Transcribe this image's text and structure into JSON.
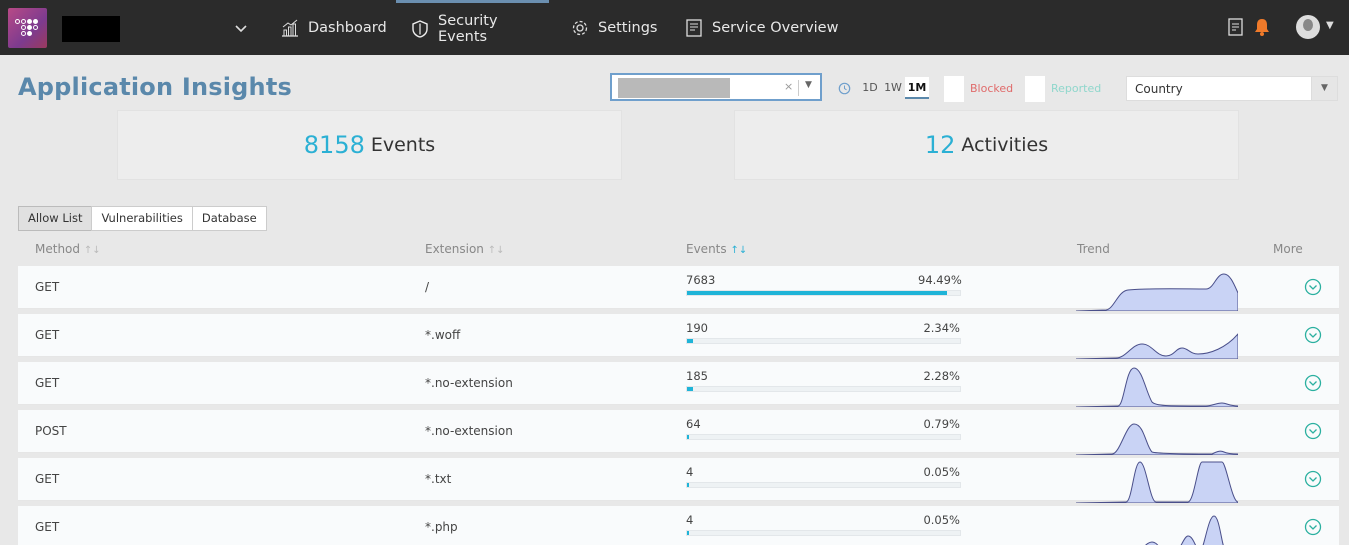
{
  "nav": {
    "items": [
      {
        "label": "Dashboard",
        "icon": "dashboard-chart-icon"
      },
      {
        "label": "Security Events",
        "icon": "shield-icon"
      },
      {
        "label": "Settings",
        "icon": "gear-icon"
      },
      {
        "label": "Service Overview",
        "icon": "document-icon"
      }
    ],
    "active": "Security Events"
  },
  "page": {
    "title": "Application Insights"
  },
  "filters": {
    "time_ranges": [
      "1D",
      "1W",
      "1M"
    ],
    "active_range": "1M",
    "blocked_label": "Blocked",
    "reported_label": "Reported",
    "country_placeholder": "Country"
  },
  "stats": {
    "events_count": "8158",
    "events_label": "Events",
    "activities_count": "12",
    "activities_label": "Activities"
  },
  "tabs": [
    "Allow List",
    "Vulnerabilities",
    "Database"
  ],
  "active_tab": "Allow List",
  "table": {
    "columns": {
      "method": "Method",
      "extension": "Extension",
      "events": "Events",
      "trend": "Trend",
      "more": "More"
    },
    "rows": [
      {
        "method": "GET",
        "extension": "/",
        "events": "7683",
        "percent": "94.49%",
        "fraction": 0.9449
      },
      {
        "method": "GET",
        "extension": "*.woff",
        "events": "190",
        "percent": "2.34%",
        "fraction": 0.0234
      },
      {
        "method": "GET",
        "extension": "*.no-extension",
        "events": "185",
        "percent": "2.28%",
        "fraction": 0.0228
      },
      {
        "method": "POST",
        "extension": "*.no-extension",
        "events": "64",
        "percent": "0.79%",
        "fraction": 0.0079
      },
      {
        "method": "GET",
        "extension": "*.txt",
        "events": "4",
        "percent": "0.05%",
        "fraction": 0.0005
      },
      {
        "method": "GET",
        "extension": "*.php",
        "events": "4",
        "percent": "0.05%",
        "fraction": 0.0005
      }
    ]
  },
  "colors": {
    "topbar": "#2b2b2b",
    "title": "#5a88ab",
    "accent": "#1fb4d8",
    "blocked": "#e06b6b",
    "reported": "#8fd7cc",
    "bell": "#f07a2a",
    "sparkline_fill": "#c9d3f5",
    "sparkline_line": "#4a4f8a"
  }
}
